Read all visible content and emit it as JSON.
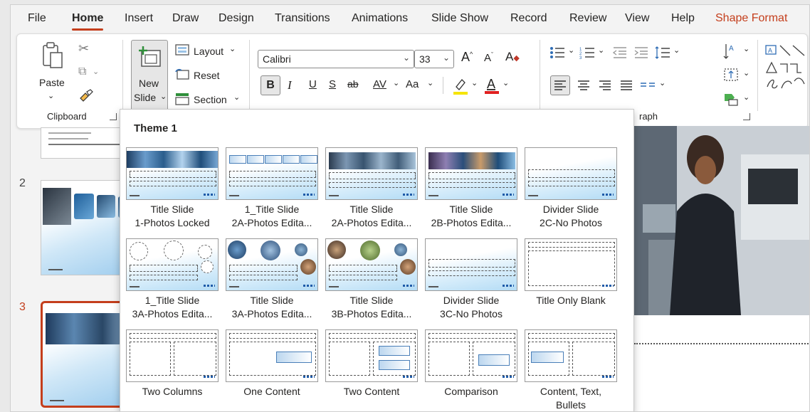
{
  "menu": {
    "items": [
      "File",
      "Home",
      "Insert",
      "Draw",
      "Design",
      "Transitions",
      "Animations",
      "Slide Show",
      "Record",
      "Review",
      "View",
      "Help",
      "Shape Format"
    ],
    "active": "Home"
  },
  "ribbon": {
    "clipboard": {
      "paste_label": "Paste",
      "group_label": "Clipboard"
    },
    "slides": {
      "new_slide_line1": "New",
      "new_slide_line2": "Slide",
      "layout_label": "Layout",
      "reset_label": "Reset",
      "section_label": "Section"
    },
    "font": {
      "font_name": "Calibri",
      "font_size": "33",
      "bold": "B",
      "italic": "I",
      "underline": "U",
      "shadow": "S",
      "strikethrough": "ab",
      "spacing": "AV",
      "change_case": "Aa",
      "grow": "A",
      "shrink": "A"
    },
    "paragraph": {
      "group_label": "raph"
    }
  },
  "slides_panel": {
    "numbers": [
      "2",
      "3"
    ],
    "selected": "3"
  },
  "gallery": {
    "title": "Theme 1",
    "layouts": [
      {
        "line1": "Title Slide",
        "line2": "1-Photos Locked"
      },
      {
        "line1": "1_Title Slide",
        "line2": "2A-Photos Edita..."
      },
      {
        "line1": "Title Slide",
        "line2": "2A-Photos Edita..."
      },
      {
        "line1": "Title Slide",
        "line2": "2B-Photos Edita..."
      },
      {
        "line1": "Divider Slide",
        "line2": "2C-No Photos"
      },
      {
        "line1": "1_Title Slide",
        "line2": "3A-Photos Edita..."
      },
      {
        "line1": "Title Slide",
        "line2": "3A-Photos Edita..."
      },
      {
        "line1": "Title Slide",
        "line2": "3B-Photos Edita..."
      },
      {
        "line1": "Divider Slide",
        "line2": "3C-No Photos"
      },
      {
        "line1": "Title Only Blank",
        "line2": ""
      },
      {
        "line1": "Two Columns",
        "line2": ""
      },
      {
        "line1": "One Content",
        "line2": ""
      },
      {
        "line1": "Two Content",
        "line2": ""
      },
      {
        "line1": "Comparison",
        "line2": ""
      },
      {
        "line1": "Content, Text,",
        "line2": "Bullets"
      }
    ]
  },
  "colors": {
    "accent": "#c43e1c",
    "font_color_bar": "#e02020",
    "highlight_bar": "#f5e400"
  }
}
